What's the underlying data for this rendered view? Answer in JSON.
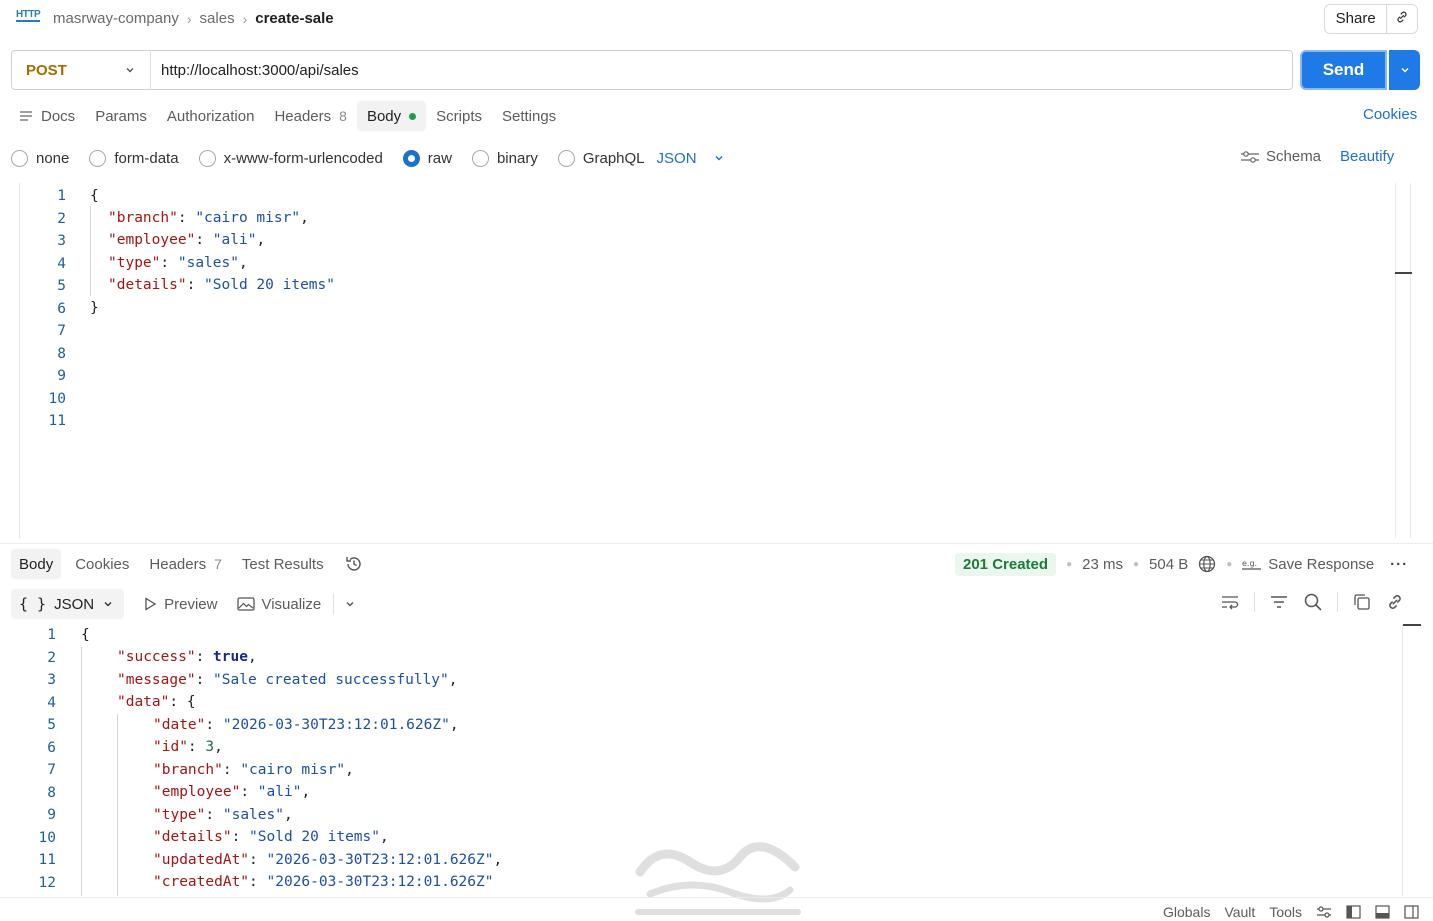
{
  "header": {
    "badge": "HTTP",
    "breadcrumb": [
      "masrway-company",
      "sales",
      "create-sale"
    ],
    "share_label": "Share"
  },
  "request": {
    "method": "POST",
    "url": "http://localhost:3000/api/sales",
    "send_label": "Send",
    "tabs": [
      {
        "label": "Docs"
      },
      {
        "label": "Params"
      },
      {
        "label": "Authorization"
      },
      {
        "label": "Headers",
        "count": "8"
      },
      {
        "label": "Body"
      },
      {
        "label": "Scripts"
      },
      {
        "label": "Settings"
      }
    ],
    "cookies_label": "Cookies",
    "body_types": [
      "none",
      "form-data",
      "x-www-form-urlencoded",
      "raw",
      "binary",
      "GraphQL"
    ],
    "selected_body_type": "raw",
    "language": "JSON",
    "schema_label": "Schema",
    "beautify_label": "Beautify",
    "line_numbers": [
      "1",
      "2",
      "3",
      "4",
      "5",
      "6",
      "7",
      "8",
      "9",
      "10",
      "11"
    ]
  },
  "response": {
    "tabs": [
      {
        "label": "Body"
      },
      {
        "label": "Cookies"
      },
      {
        "label": "Headers",
        "count": "7"
      },
      {
        "label": "Test Results"
      }
    ],
    "status": "201 Created",
    "time": "23 ms",
    "size": "504 B",
    "save_label": "Save Response",
    "format": "JSON",
    "preview_label": "Preview",
    "visualize_label": "Visualize",
    "line_numbers": [
      "1",
      "2",
      "3",
      "4",
      "5",
      "6",
      "7",
      "8",
      "9",
      "10",
      "11",
      "12"
    ]
  },
  "footer": {
    "items": [
      "Globals",
      "Vault",
      "Tools"
    ]
  },
  "colors": {
    "accent": "#1f79e6",
    "method": "#a86b00",
    "status_ok": "#1e7a3c"
  }
}
